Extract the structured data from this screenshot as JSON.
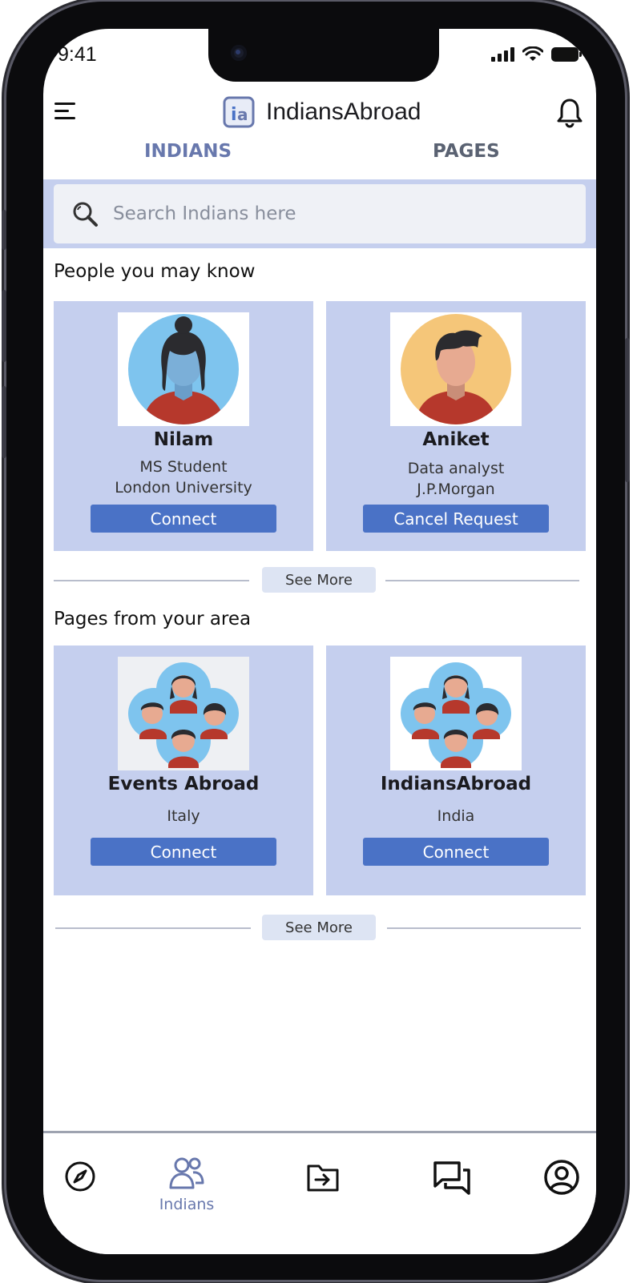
{
  "status_bar": {
    "time": "9:41"
  },
  "header": {
    "app_title": "IndiansAbroad"
  },
  "tabs": [
    {
      "label": "INDIANS",
      "active": true
    },
    {
      "label": "PAGES",
      "active": false
    }
  ],
  "search": {
    "placeholder": "Search Indians here"
  },
  "people_section": {
    "title": "People you may know",
    "cards": [
      {
        "name": "Nilam",
        "line1": "MS Student",
        "line2": "London University",
        "button": "Connect"
      },
      {
        "name": "Aniket",
        "line1": "Data analyst",
        "line2": "J.P.Morgan",
        "button": "Cancel Request"
      }
    ],
    "see_more": "See More"
  },
  "pages_section": {
    "title": "Pages from your area",
    "cards": [
      {
        "name": "Events Abroad",
        "location": "Italy",
        "button": "Connect"
      },
      {
        "name": "IndiansAbroad",
        "location": "India",
        "button": "Connect"
      }
    ],
    "see_more": "See More"
  },
  "bottom_nav": {
    "items": [
      {
        "icon": "compass-icon",
        "label": ""
      },
      {
        "icon": "people-icon",
        "label": "Indians",
        "active": true
      },
      {
        "icon": "folder-arrow-icon",
        "label": ""
      },
      {
        "icon": "chat-icon",
        "label": ""
      },
      {
        "icon": "profile-icon",
        "label": ""
      }
    ]
  },
  "colors": {
    "accent": "#4a72c6",
    "card_bg": "#c5cfee",
    "tab_active": "#6878ad"
  }
}
